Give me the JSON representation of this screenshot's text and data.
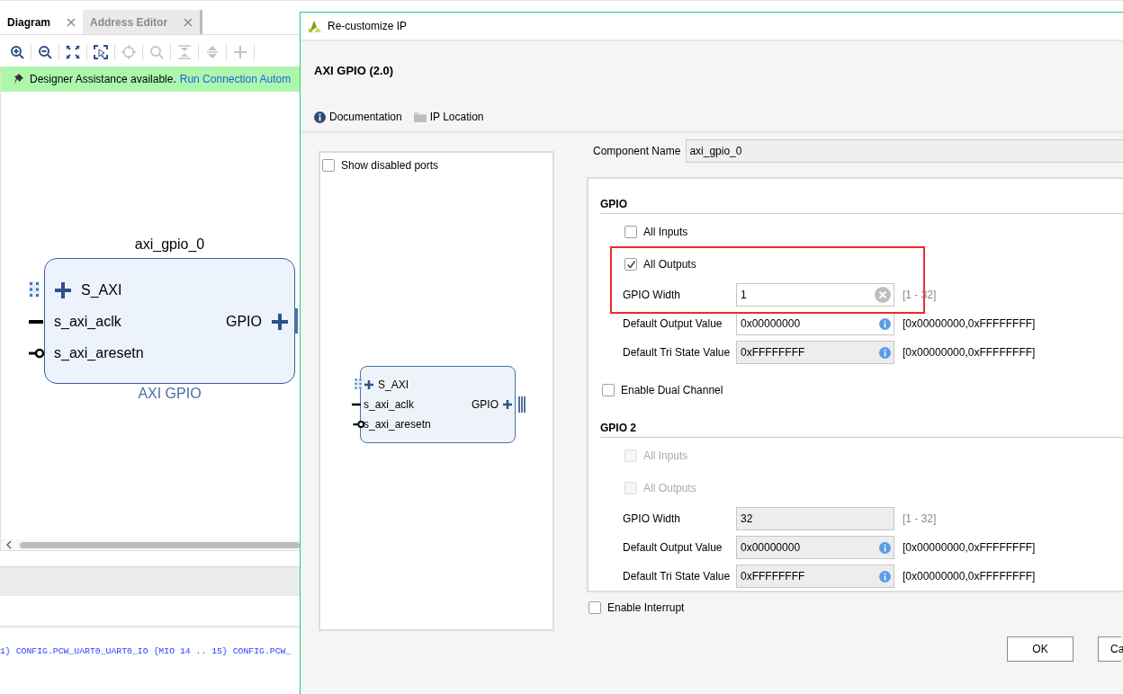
{
  "left_pane": {
    "tabs": [
      {
        "label": "Diagram",
        "selected": true
      },
      {
        "label": "Address Editor",
        "selected": false
      }
    ],
    "toolbar": [
      {
        "kind": "zoom_in",
        "disabled": false
      },
      {
        "kind": "zoom_out",
        "disabled": false
      },
      {
        "kind": "fit",
        "disabled": false
      },
      {
        "kind": "select_area",
        "disabled": false
      },
      {
        "kind": "crosshair",
        "disabled": true
      },
      {
        "kind": "search",
        "disabled": true
      },
      {
        "kind": "collapse",
        "disabled": true
      },
      {
        "kind": "expand",
        "disabled": true
      },
      {
        "kind": "add",
        "disabled": true
      }
    ],
    "banner": {
      "text": "Designer Assistance available.",
      "link": "Run Connection Autom"
    },
    "diagram": {
      "block": {
        "name": "axi_gpio_0",
        "type_label": "AXI GPIO",
        "ports_left": [
          {
            "name": "S_AXI",
            "kind": "bus"
          },
          {
            "name": "s_axi_aclk",
            "kind": "clock"
          },
          {
            "name": "s_axi_aresetn",
            "kind": "reset"
          }
        ],
        "ports_right": [
          {
            "name": "GPIO",
            "kind": "bus"
          }
        ]
      }
    },
    "console": {
      "line": "1} CONFIG.PCW_UART0_UART0_IO {MIO 14 .. 15} CONFIG.PCW_"
    }
  },
  "dialog": {
    "title": "Re-customize IP",
    "ip_name": "AXI GPIO (2.0)",
    "links": [
      {
        "kind": "info",
        "label": "Documentation"
      },
      {
        "kind": "folder",
        "label": "IP Location"
      }
    ],
    "preview": {
      "show_disabled_ports": {
        "label": "Show disabled ports",
        "checked": false
      },
      "block": {
        "ports_left": [
          {
            "name": "S_AXI",
            "kind": "bus"
          },
          {
            "name": "s_axi_aclk",
            "kind": "clock"
          },
          {
            "name": "s_axi_aresetn",
            "kind": "reset"
          }
        ],
        "ports_right": [
          {
            "name": "GPIO",
            "kind": "bus"
          }
        ]
      }
    },
    "component_name": {
      "label": "Component Name",
      "value": "axi_gpio_0"
    },
    "items": [
      {
        "kind": "heading",
        "title": "GPIO"
      },
      {
        "kind": "checkbox",
        "label": "All Inputs",
        "checked": false,
        "disabled": false,
        "highlighted": false
      },
      {
        "kind": "checkbox",
        "label": "All Outputs",
        "checked": true,
        "disabled": false,
        "highlighted": true
      },
      {
        "kind": "field",
        "label": "GPIO Width",
        "value": "1",
        "disabled": false,
        "clear_button": true,
        "range": "[1 - 32]",
        "range_dimmed": true,
        "highlighted": true
      },
      {
        "kind": "field",
        "label": "Default Output Value",
        "value": "0x00000000",
        "disabled": false,
        "info_button": true,
        "range": "[0x00000000,0xFFFFFFFF]",
        "range_dimmed": false,
        "highlighted": false
      },
      {
        "kind": "field",
        "label": "Default Tri State Value",
        "value": "0xFFFFFFFF",
        "disabled": true,
        "info_button": true,
        "range": "[0x00000000,0xFFFFFFFF]",
        "range_dimmed": false,
        "highlighted": false
      },
      {
        "kind": "option",
        "label": "Enable Dual Channel",
        "checked": false
      },
      {
        "kind": "heading",
        "title": "GPIO 2"
      },
      {
        "kind": "checkbox",
        "label": "All Inputs",
        "checked": false,
        "disabled": true,
        "highlighted": false
      },
      {
        "kind": "checkbox",
        "label": "All Outputs",
        "checked": false,
        "disabled": true,
        "highlighted": false
      },
      {
        "kind": "field",
        "label": "GPIO Width",
        "value": "32",
        "disabled": true,
        "range": "[1 - 32]",
        "range_dimmed": true,
        "highlighted": false
      },
      {
        "kind": "field",
        "label": "Default Output Value",
        "value": "0x00000000",
        "disabled": true,
        "info_button": true,
        "range": "[0x00000000,0xFFFFFFFF]",
        "range_dimmed": false,
        "highlighted": false
      },
      {
        "kind": "field",
        "label": "Default Tri State Value",
        "value": "0xFFFFFFFF",
        "disabled": true,
        "info_button": true,
        "range": "[0x00000000,0xFFFFFFFF]",
        "range_dimmed": false,
        "highlighted": false
      }
    ],
    "enable_interrupt": {
      "label": "Enable Interrupt",
      "checked": false
    },
    "buttons": [
      {
        "label": "OK",
        "cut": false
      },
      {
        "label": "Ca",
        "cut": true
      }
    ]
  }
}
